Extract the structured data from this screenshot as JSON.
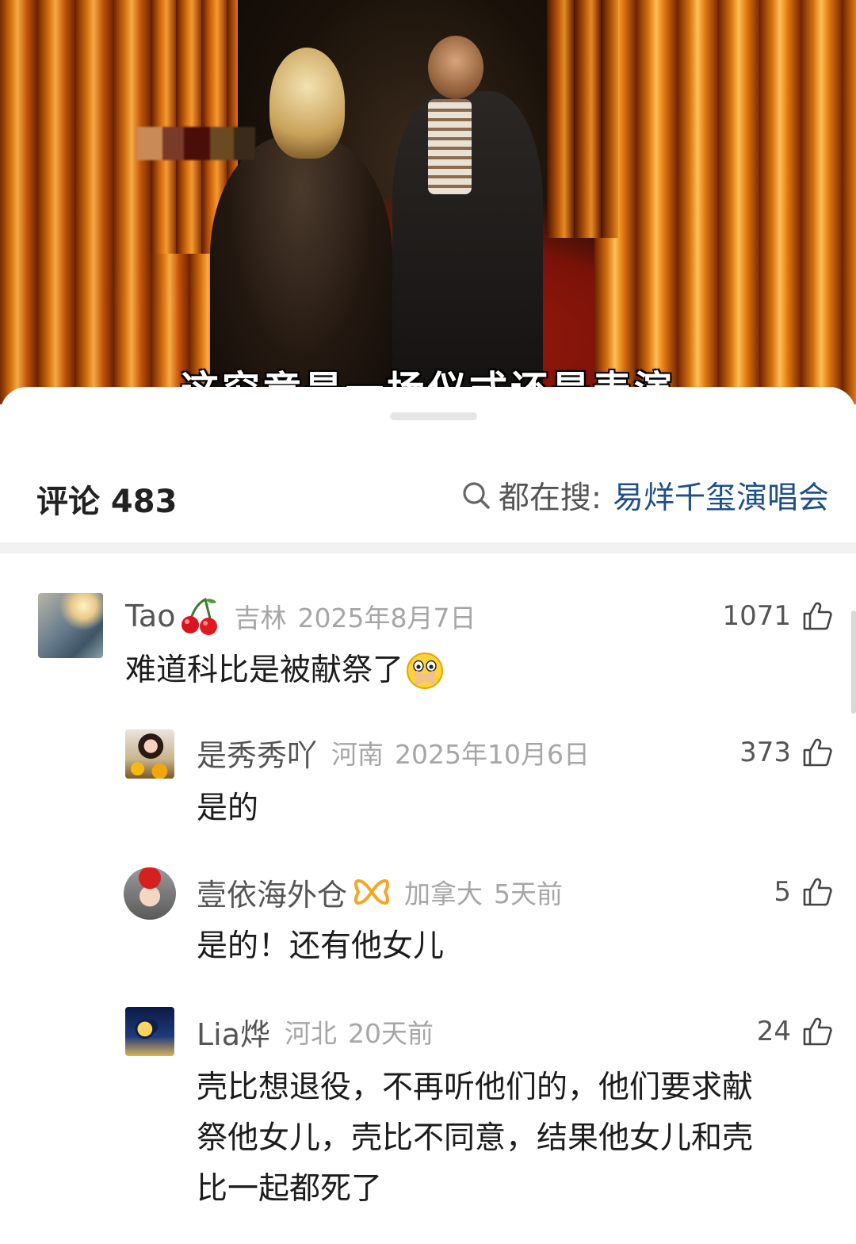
{
  "video": {
    "subtitle": "这究竟是一场仪式还是表演"
  },
  "comments_panel": {
    "title": "评论 483",
    "search_prefix": "都在搜:",
    "search_term": "易烊千玺演唱会"
  },
  "comments": [
    {
      "name": "Tao",
      "name_badge_icon": "cherry-icon",
      "location": "吉林",
      "date": "2025年8月7日",
      "likes": "1071",
      "text": "难道科比是被献祭了",
      "emoji_icon": "shushing-face-emoji-icon"
    },
    {
      "name": "是秀秀吖",
      "location": "河南",
      "date": "2025年10月6日",
      "likes": "373",
      "text": "是的"
    },
    {
      "name": "壹依海外仓",
      "name_badge_icon": "orange-ribbon-badge-icon",
      "location": "加拿大",
      "date": "5天前",
      "likes": "5",
      "text": "是的！还有他女儿"
    },
    {
      "name": "Lia烨",
      "location": "河北",
      "date": "20天前",
      "likes": "24",
      "text_lines": [
        "壳比想退役，不再听他们的，他们要求献",
        "祭他女儿，壳比不同意，结果他女儿和壳",
        "比一起都死了"
      ]
    }
  ],
  "colors": {
    "link": "#1f4f8a",
    "meta": "#a6a6a6",
    "name": "#555555",
    "text": "#1c1c1c"
  }
}
